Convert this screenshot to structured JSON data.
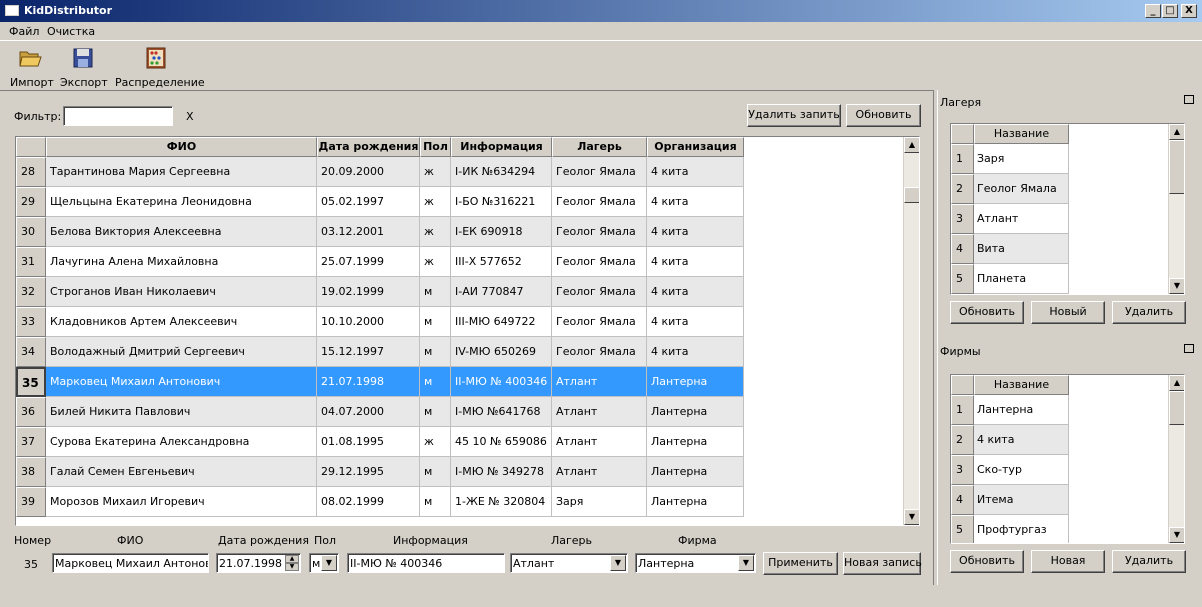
{
  "window": {
    "title": "KidDistributor",
    "min": "_",
    "max": "□",
    "close": "X"
  },
  "menu": [
    "Файл",
    "Очистка"
  ],
  "toolbar": [
    {
      "label": "Импорт",
      "icon": "folder-open-icon"
    },
    {
      "label": "Экспорт",
      "icon": "floppy-disk-icon"
    },
    {
      "label": "Распределение",
      "icon": "abacus-icon"
    }
  ],
  "filter": {
    "label": "Фильтр:",
    "value": "",
    "clear": "X"
  },
  "buttons": {
    "delete_record": "Удалить запить",
    "refresh": "Обновить",
    "apply": "Применить",
    "new_record": "Новая запись"
  },
  "table": {
    "columns": [
      "ФИО",
      "Дата рождения",
      "Пол",
      "Информация",
      "Лагерь",
      "Организация"
    ],
    "rows": [
      {
        "n": "28",
        "fio": "Тарантинова Мария Сергеевна",
        "dob": "20.09.2000",
        "sex": "ж",
        "info": "I-ИК №634294",
        "camp": "Геолог Ямала",
        "org": "4 кита"
      },
      {
        "n": "29",
        "fio": "Щельцына Екатерина Леонидовна",
        "dob": "05.02.1997",
        "sex": "ж",
        "info": "I-БО №316221",
        "camp": "Геолог Ямала",
        "org": "4 кита"
      },
      {
        "n": "30",
        "fio": "Белова Виктория Алексеевна",
        "dob": "03.12.2001",
        "sex": "ж",
        "info": "I-ЕК 690918",
        "camp": "Геолог Ямала",
        "org": "4 кита"
      },
      {
        "n": "31",
        "fio": "Лачугина Алена Михайловна",
        "dob": "25.07.1999",
        "sex": "ж",
        "info": "III-Х 577652",
        "camp": "Геолог Ямала",
        "org": "4 кита"
      },
      {
        "n": "32",
        "fio": "Строганов Иван Николаевич",
        "dob": "19.02.1999",
        "sex": "м",
        "info": "I-АИ 770847",
        "camp": "Геолог Ямала",
        "org": "4 кита"
      },
      {
        "n": "33",
        "fio": "Кладовников Артем Алексеевич",
        "dob": "10.10.2000",
        "sex": "м",
        "info": "III-МЮ 649722",
        "camp": "Геолог Ямала",
        "org": "4 кита"
      },
      {
        "n": "34",
        "fio": "Володажный Дмитрий Сергеевич",
        "dob": "15.12.1997",
        "sex": "м",
        "info": "IV-МЮ 650269",
        "camp": "Геолог Ямала",
        "org": "4 кита"
      },
      {
        "n": "35",
        "fio": "Марковец Михаил Антонович",
        "dob": "21.07.1998",
        "sex": "м",
        "info": "II-МЮ № 400346",
        "camp": "Атлант",
        "org": "Лантерна",
        "selected": true
      },
      {
        "n": "36",
        "fio": "Билей Никита Павлович",
        "dob": "04.07.2000",
        "sex": "м",
        "info": "I-МЮ №641768",
        "camp": "Атлант",
        "org": "Лантерна"
      },
      {
        "n": "37",
        "fio": "Сурова Екатерина Александровна",
        "dob": "01.08.1995",
        "sex": "ж",
        "info": "45 10 № 659086",
        "camp": "Атлант",
        "org": "Лантерна"
      },
      {
        "n": "38",
        "fio": "Галай Семен Евгеньевич",
        "dob": "29.12.1995",
        "sex": "м",
        "info": "I-МЮ  № 349278",
        "camp": "Атлант",
        "org": "Лантерна"
      },
      {
        "n": "39",
        "fio": "Морозов Михаил Игоревич",
        "dob": "08.02.1999",
        "sex": "м",
        "info": "1-ЖЕ № 320804",
        "camp": "Заря",
        "org": "Лантерна"
      }
    ]
  },
  "editor": {
    "labels": {
      "num": "Номер",
      "fio": "ФИО",
      "dob": "Дата рождения",
      "sex": "Пол",
      "info": "Информация",
      "camp": "Лагерь",
      "firm": "Фирма"
    },
    "values": {
      "num": "35",
      "fio": "Марковец Михаил Антонович",
      "dob": "21.07.1998",
      "sex": "м",
      "info": "II-МЮ № 400346",
      "camp": "Атлант",
      "firm": "Лантерна"
    }
  },
  "camps": {
    "title": "Лагеря",
    "column": "Название",
    "items": [
      "Заря",
      "Геолог Ямала",
      "Атлант",
      "Вита",
      "Планета"
    ],
    "buttons": {
      "refresh": "Обновить",
      "new": "Новый",
      "delete": "Удалить"
    }
  },
  "firms": {
    "title": "Фирмы",
    "column": "Название",
    "items": [
      "Лантерна",
      "4 кита",
      "Ско-тур",
      "Итема",
      "Профтургаз"
    ],
    "buttons": {
      "refresh": "Обновить",
      "new": "Новая",
      "delete": "Удалить"
    }
  }
}
